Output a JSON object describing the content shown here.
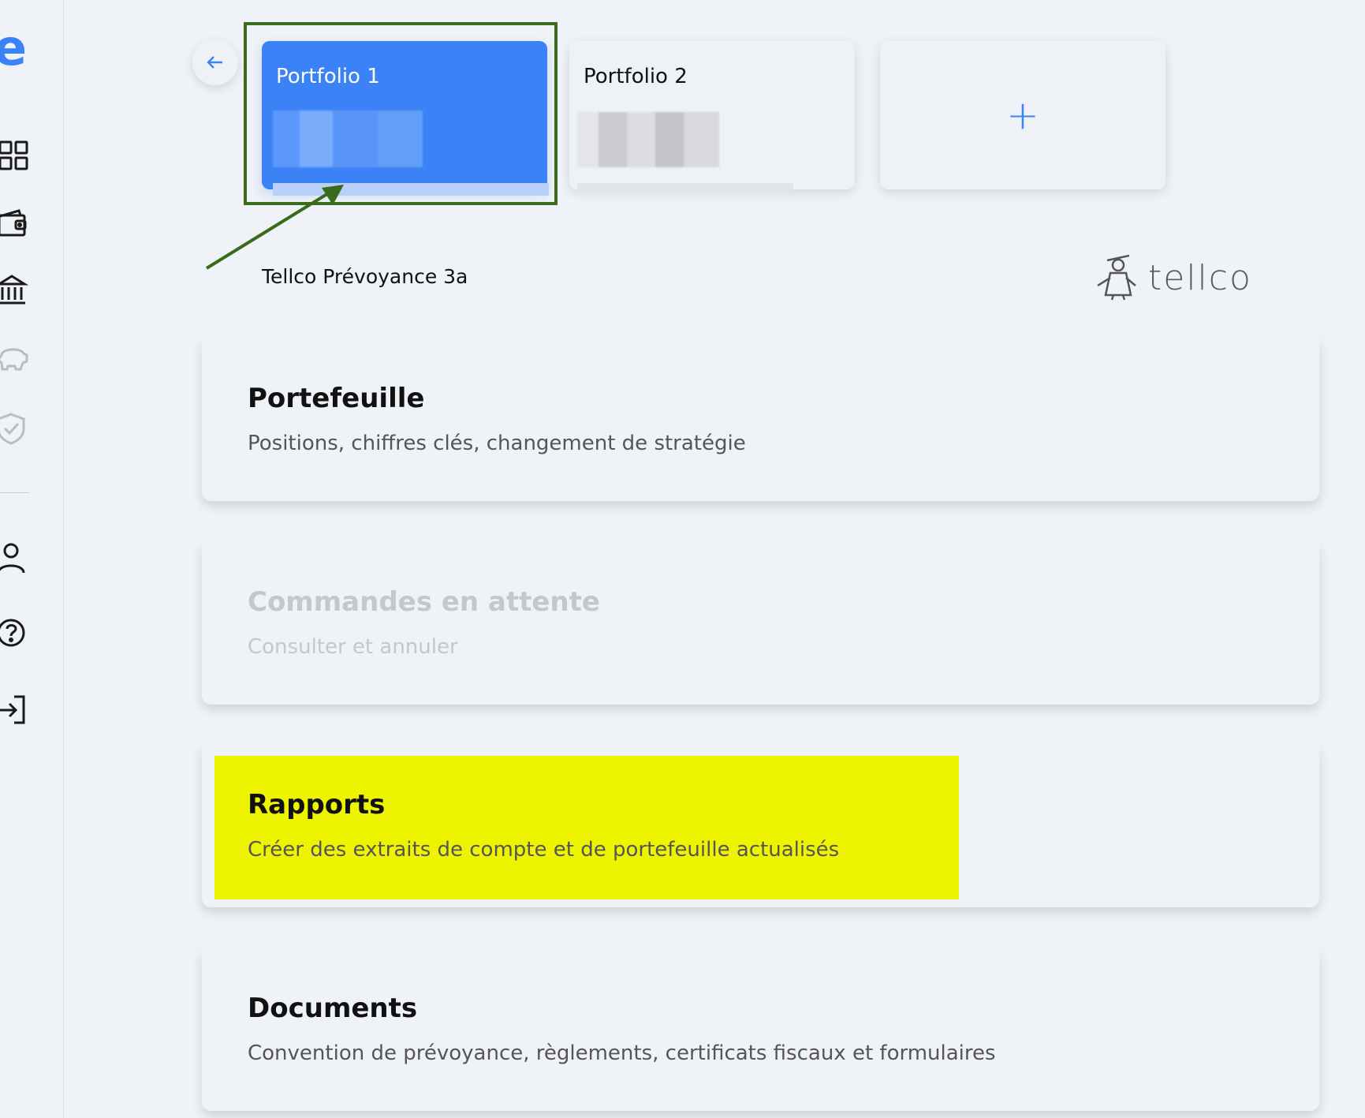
{
  "sidebar": {
    "logo_letter": "e",
    "items": [
      {
        "name": "dashboard",
        "icon": "grid-icon"
      },
      {
        "name": "wallet",
        "icon": "wallet-icon"
      },
      {
        "name": "bank",
        "icon": "bank-icon"
      },
      {
        "name": "savings",
        "icon": "piggy-bank-icon"
      },
      {
        "name": "insurance",
        "icon": "shield-check-icon"
      },
      {
        "name": "profile",
        "icon": "user-icon"
      },
      {
        "name": "help",
        "icon": "help-circle-icon"
      },
      {
        "name": "logout",
        "icon": "logout-icon"
      }
    ]
  },
  "tabs": {
    "back_icon": "arrow-left-icon",
    "items": [
      {
        "label": "Portfolio 1",
        "active": true
      },
      {
        "label": "Portfolio 2",
        "active": false
      }
    ],
    "add_label": "+"
  },
  "provider": {
    "name": "Tellco Prévoyance 3a",
    "logo_text": "tellco"
  },
  "cards": [
    {
      "title": "Portefeuille",
      "subtitle": "Positions, chiffres clés, changement de stratégie",
      "disabled": false
    },
    {
      "title": "Commandes en attente",
      "subtitle": "Consulter et annuler",
      "disabled": true
    },
    {
      "title": "Rapports",
      "subtitle": "Créer des extraits de compte et de portefeuille actualisés",
      "disabled": false,
      "highlighted": true
    },
    {
      "title": "Documents",
      "subtitle": "Convention de prévoyance, règlements, certificats fiscaux et formulaires",
      "disabled": false
    }
  ],
  "colors": {
    "accent": "#3b82f6",
    "background": "#eff2f6",
    "annotation_green": "#3a6b1a",
    "highlight_yellow": "#eef300"
  }
}
